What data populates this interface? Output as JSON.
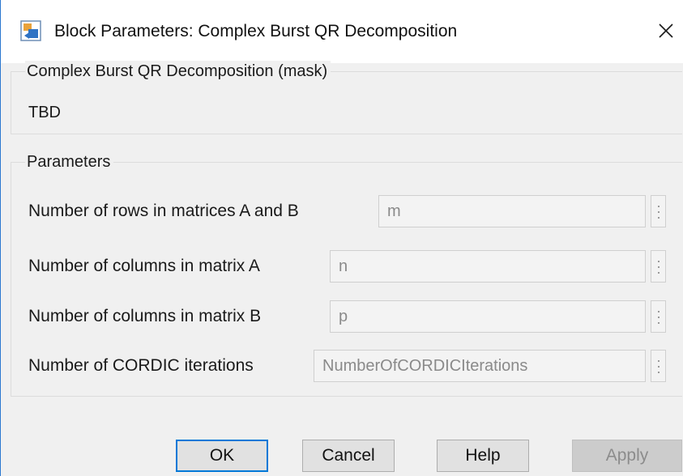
{
  "window": {
    "title": "Block Parameters: Complex Burst QR Decomposition",
    "icon": "simulink-block-icon",
    "close_icon": "close-icon"
  },
  "mask_group": {
    "legend": "Complex Burst QR Decomposition (mask)",
    "description": "TBD"
  },
  "parameters_group": {
    "legend": "Parameters",
    "fields": [
      {
        "label": "Number of rows in matrices A and B",
        "value": "m"
      },
      {
        "label": "Number of columns in matrix A",
        "value": "n"
      },
      {
        "label": "Number of columns in matrix B",
        "value": "p"
      },
      {
        "label": "Number of CORDIC iterations",
        "value": "NumberOfCORDICIterations"
      }
    ]
  },
  "buttons": {
    "ok": "OK",
    "cancel": "Cancel",
    "help": "Help",
    "apply": "Apply"
  },
  "colors": {
    "accent": "#0078d7",
    "window_bg": "#f0f0f0",
    "disabled_text": "#8c8c8c"
  }
}
